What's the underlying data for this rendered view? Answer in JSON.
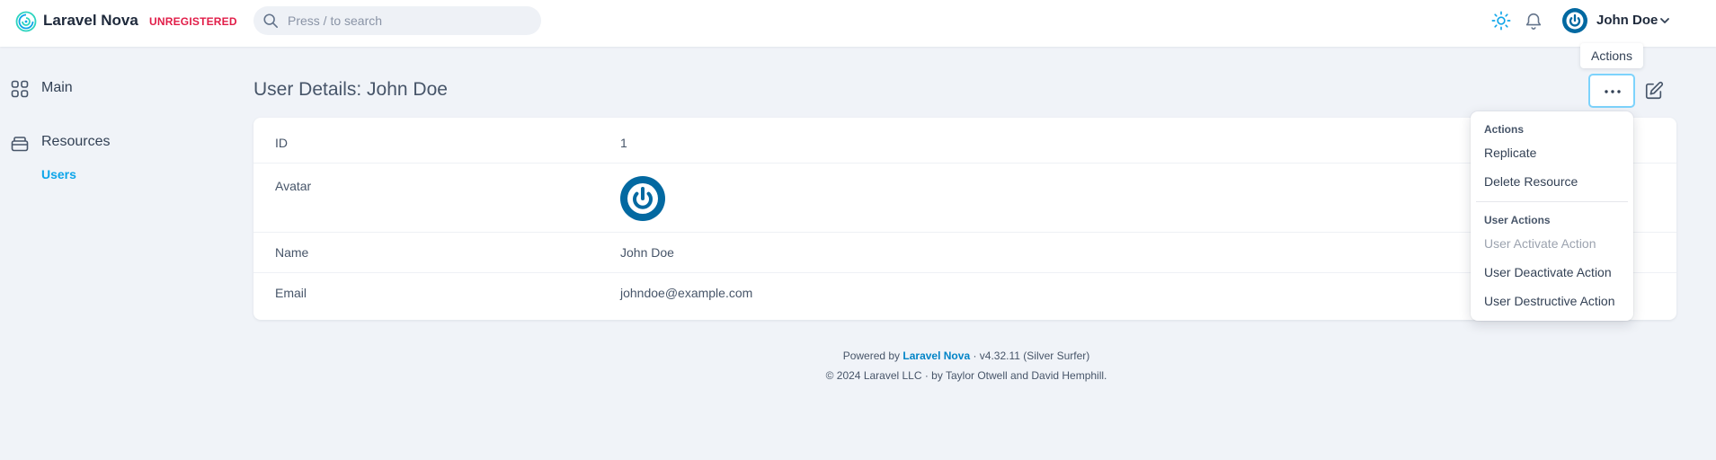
{
  "app": {
    "name": "Laravel Nova",
    "badge": "UNREGISTERED",
    "brand_color": "#0ea5e9",
    "badge_color": "#e11d48"
  },
  "header": {
    "search": {
      "placeholder": "Press / to search",
      "value": ""
    },
    "icons": [
      "search-icon",
      "sun-icon",
      "bell-icon",
      "power-icon",
      "chevron-down-icon"
    ],
    "user_name": "John Doe"
  },
  "sidebar": {
    "items": [
      {
        "label": "Main",
        "icon": "grid-icon"
      },
      {
        "label": "Resources",
        "icon": "archive-icon"
      }
    ],
    "sub_items": [
      {
        "label": "Users",
        "active": true
      }
    ]
  },
  "page": {
    "title": "User Details: John Doe",
    "actions_tooltip": "Actions"
  },
  "details": {
    "fields": [
      {
        "label": "ID",
        "value": "1"
      },
      {
        "label": "Avatar",
        "value": ""
      },
      {
        "label": "Name",
        "value": "John Doe"
      },
      {
        "label": "Email",
        "value": "johndoe@example.com"
      }
    ]
  },
  "dropdown": {
    "groups": [
      {
        "heading": "Actions",
        "items": [
          {
            "label": "Replicate",
            "disabled": false
          },
          {
            "label": "Delete Resource",
            "disabled": false
          }
        ]
      },
      {
        "heading": "User Actions",
        "items": [
          {
            "label": "User Activate Action",
            "disabled": true
          },
          {
            "label": "User Deactivate Action",
            "disabled": false
          },
          {
            "label": "User Destructive Action",
            "disabled": false
          }
        ]
      }
    ]
  },
  "footer": {
    "powered_prefix": "Powered by",
    "powered_link": "Laravel Nova",
    "powered_suffix": "· v4.32.11 (Silver Surfer)",
    "copyright": "© 2024 Laravel LLC · by Taylor Otwell and David Hemphill."
  }
}
